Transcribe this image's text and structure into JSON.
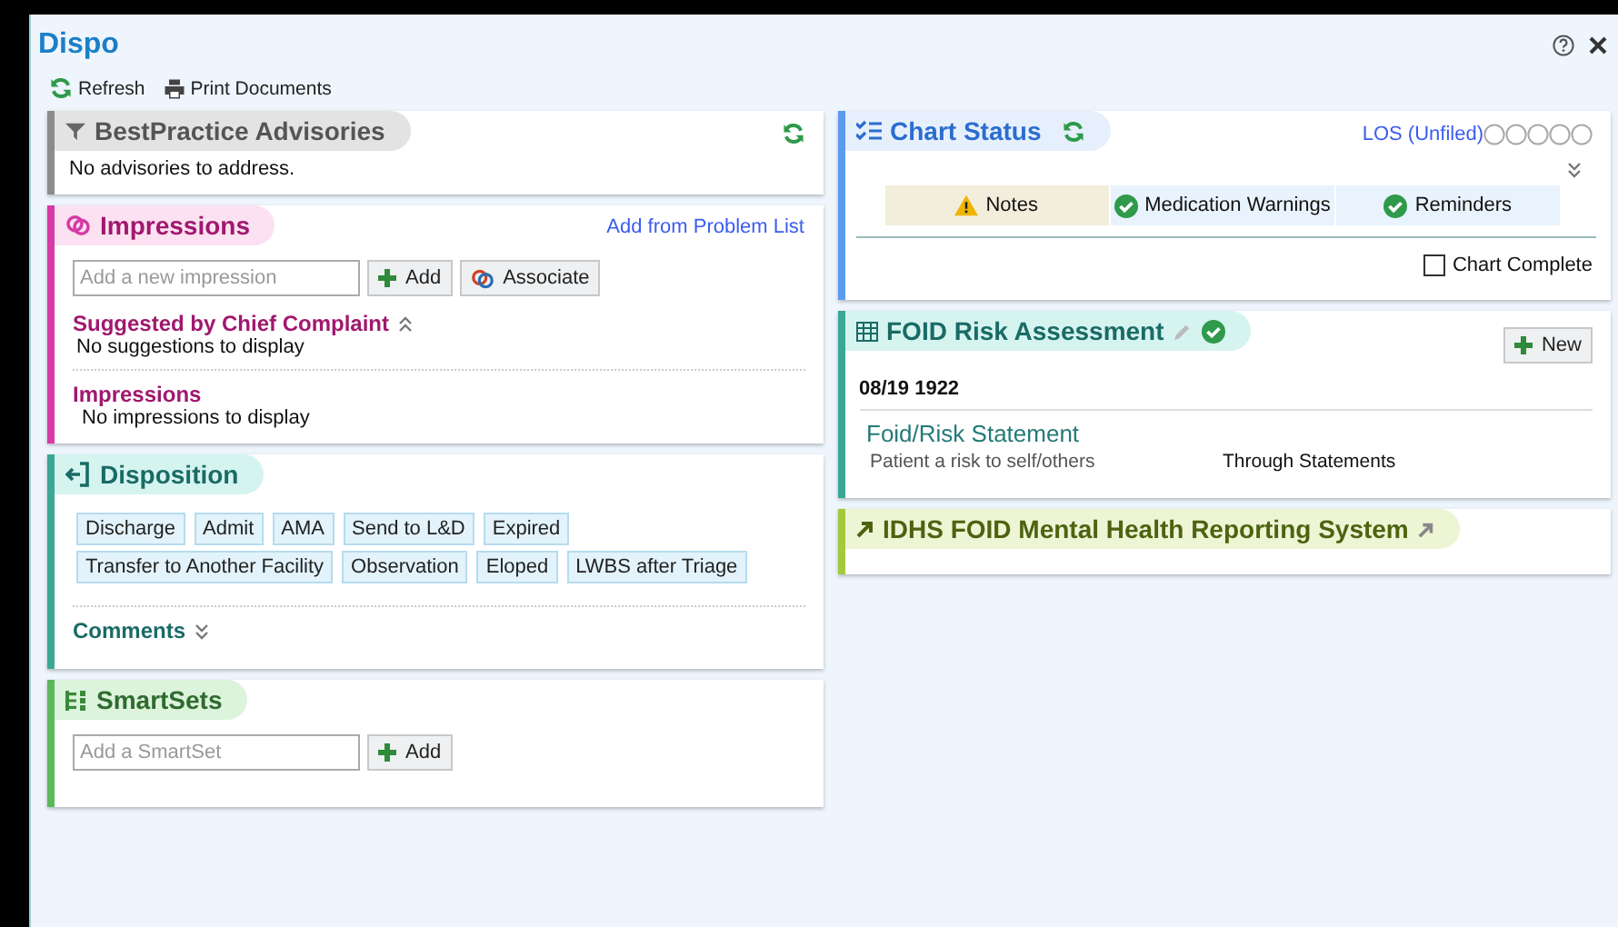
{
  "window": {
    "title": "Dispo"
  },
  "toolbar": [
    {
      "kind": "refresh",
      "label": "Refresh"
    },
    {
      "kind": "print",
      "label": "Print Documents"
    }
  ],
  "left_sections": [
    {
      "kind": "advisories",
      "title": "BestPractice Advisories",
      "color": "#8c8c8c",
      "message": "No advisories to address."
    },
    {
      "kind": "impressions",
      "title": "Impressions",
      "color": "#d63aa4",
      "link": "Add from Problem List",
      "field": {
        "placeholder": "Add a new impression"
      },
      "buttons": [
        {
          "kind": "add",
          "label": "Add"
        },
        {
          "kind": "associate",
          "label": "Associate"
        }
      ],
      "groups": [
        {
          "title": "Suggested by Chief Complaint",
          "expanded": true,
          "message": "No suggestions to display"
        },
        {
          "title": "Impressions",
          "message": "No impressions to display"
        }
      ]
    },
    {
      "kind": "disposition",
      "title": "Disposition",
      "color": "#3aa894",
      "options": [
        "Discharge",
        "Admit",
        "AMA",
        "Send to L&D",
        "Expired",
        "Transfer to Another Facility",
        "Observation",
        "Eloped",
        "LWBS after Triage"
      ],
      "comments": {
        "label": "Comments",
        "expanded": false
      }
    },
    {
      "kind": "smartsets",
      "title": "SmartSets",
      "color": "#5cb85c",
      "field": {
        "placeholder": "Add a SmartSet"
      },
      "buttons": [
        {
          "kind": "add",
          "label": "Add"
        }
      ]
    }
  ],
  "right_sections": [
    {
      "kind": "chart_status",
      "title": "Chart Status",
      "color": "#5b9bef",
      "los": "LOS (Unfiled)",
      "expanded": false,
      "tabs": [
        {
          "label": "Notes",
          "warning": true
        },
        {
          "label": "Medication Warnings",
          "warning": false
        },
        {
          "label": "Reminders",
          "warning": false
        }
      ],
      "chart_complete": {
        "label": "Chart Complete",
        "checked": false
      }
    },
    {
      "kind": "foid",
      "title": "FOID Risk Assessment",
      "color": "#3aa894",
      "complete": true,
      "button": {
        "kind": "add",
        "label": "New"
      },
      "date": "08/19 1922",
      "statement": "Foid/Risk Statement",
      "rows": [
        {
          "label": "Patient a risk to self/others",
          "value": "Through Statements"
        }
      ]
    },
    {
      "kind": "idhs",
      "title": "IDHS FOID Mental Health Reporting System",
      "color": "#a4c93a"
    }
  ]
}
